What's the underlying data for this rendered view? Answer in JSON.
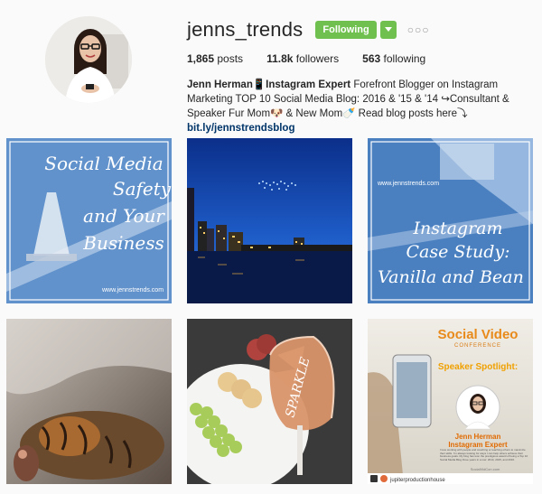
{
  "profile": {
    "username": "jenns_trends",
    "follow_label": "Following",
    "more_label": "○○○",
    "stats": {
      "posts_count": "1,865",
      "posts_label": "posts",
      "followers_count": "11.8k",
      "followers_label": "followers",
      "following_count": "563",
      "following_label": "following"
    },
    "bio": {
      "name": "Jenn Herman",
      "title": "📱Instagram Expert",
      "text": " Forefront Blogger on Instagram Marketing TOP 10 Social Media Blog: 2016 & '15 & '14 ↪Consultant & Speaker Fur Mom🐶 & New Mom🍼 Read blog posts here⤵",
      "link": "bit.ly/jennstrendsblog"
    }
  },
  "colors": {
    "following_green": "#70c050",
    "link_blue": "#003569",
    "post_blue": "#4a80c0"
  },
  "posts": [
    {
      "line1": "Social Media",
      "line2": "Safety",
      "line3": "and Your",
      "line4": "Business",
      "footer": "www.jennstrends.com"
    },
    {
      "scene": "city-skyline-night"
    },
    {
      "watermark": "www.jennstrends.com",
      "line1": "Instagram",
      "line2": "Case Study:",
      "line3": "Vanilla and Bean"
    },
    {
      "scene": "tiger-underwater"
    },
    {
      "glass_text": "SPARKLE",
      "scene": "wine-and-cheese"
    },
    {
      "title_a": "Social Video",
      "title_b": "CONFERENCE",
      "spotlight": "Speaker Spotlight:",
      "speaker_name": "Jenn Herman",
      "speaker_title": "Instagram Expert",
      "blurb": "I love working with people and coaching or teaching others to maximize their skills. I'm always looking for ways I can help others achieve their business goals. My blog has won the prestigious award of being a Top 10 Social Media Blog three years in a row: 2014, 2015, and 2016.",
      "site": "SocialVidCon.com",
      "repost_user": "jupiterproductionhouse"
    }
  ]
}
